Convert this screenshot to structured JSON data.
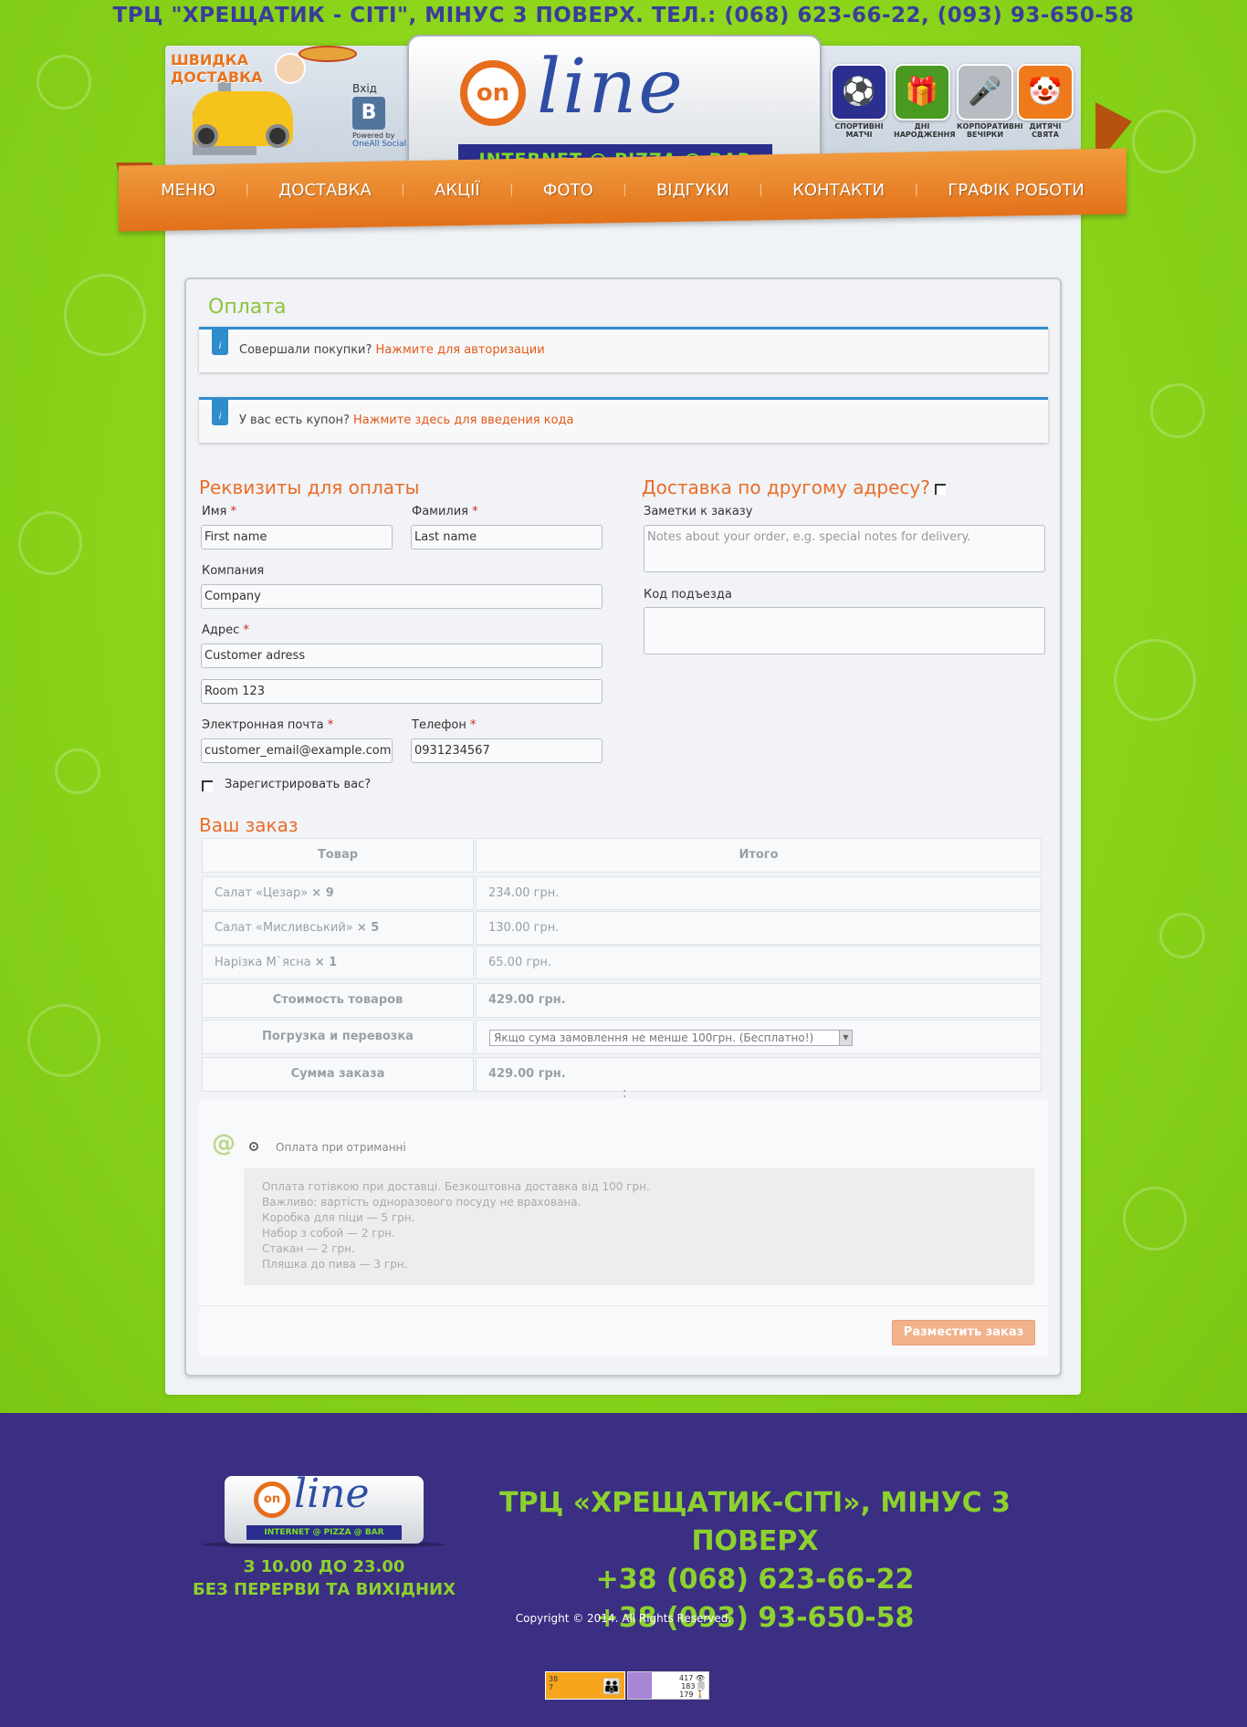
{
  "top_banner": "ТРЦ \"ХРЕЩАТИК - СІТІ\", МІНУС 3 ПОВЕРХ. ТЕЛ.: (068) 623-66-22, (093) 93-650-58",
  "header": {
    "delivery_line1": "ШВИДКА",
    "delivery_line2": "ДОСТАВКА",
    "vk_login_label": "Вхід",
    "vk_button": "B",
    "powered_by": "Powered by",
    "oneall": "OneAll Social",
    "logo_on": "on",
    "logo_line": "line",
    "logo_sub": "INTERNET @ PIZZA @ BAR",
    "events": [
      {
        "label": "СПОРТИВНІ МАТЧІ",
        "icon": "soccer-ball-icon",
        "color": "#2b2f8f",
        "glyph": "⚽"
      },
      {
        "label": "ДНІ НАРОДЖЕННЯ",
        "icon": "gift-icon",
        "color": "#4a9a22",
        "glyph": "🎁"
      },
      {
        "label": "КОРПОРАТИВНІ ВЕЧІРКИ",
        "icon": "microphone-icon",
        "color": "#b8bcc2",
        "glyph": "🎤"
      },
      {
        "label": "ДИТЯЧІ СВЯТА",
        "icon": "clown-icon",
        "color": "#ef7a1c",
        "glyph": "🤡"
      }
    ]
  },
  "nav": {
    "items": [
      "МЕНЮ",
      "ДОСТАВКА",
      "АКЦІЇ",
      "ФОТО",
      "ВІДГУКИ",
      "КОНТАКТИ",
      "ГРАФІК РОБОТИ"
    ]
  },
  "checkout": {
    "title": "Оплата",
    "login_notice": "Совершали покупки?",
    "login_link": "Нажмите для авторизации",
    "coupon_notice": "У вас есть купон?",
    "coupon_link": "Нажмите здесь для введения кода",
    "billing_title": "Реквизиты для оплаты",
    "shipping_title": "Доставка по другому адресу?",
    "first_name_label": "Имя",
    "first_name_value": "First name",
    "last_name_label": "Фамилия",
    "last_name_value": "Last name",
    "company_label": "Компания",
    "company_value": "Company",
    "address_label": "Адрес",
    "address_value": "Customer adress",
    "address2_value": "Room 123",
    "email_label": "Электронная почта",
    "email_value": "customer_email@example.com",
    "phone_label": "Телефон",
    "phone_value": "0931234567",
    "register_label": "Зарегистрировать вас?",
    "notes_label": "Заметки к заказу",
    "notes_placeholder": "Notes about your order, e.g. special notes for delivery.",
    "entrance_code_label": "Код подъезда",
    "required_mark": "*"
  },
  "order": {
    "title": "Ваш заказ",
    "col_product": "Товар",
    "col_total": "Итого",
    "items": [
      {
        "name": "Салат «Цезар»",
        "qty": "× 9",
        "total": "234.00 грн."
      },
      {
        "name": "Салат «Мисливський»",
        "qty": "× 5",
        "total": "130.00 грн."
      },
      {
        "name": "Нарізка М`ясна",
        "qty": "× 1",
        "total": "65.00 грн."
      }
    ],
    "subtotal_label": "Стоимость товаров",
    "subtotal_value": "429.00 грн.",
    "shipping_label": "Погрузка и перевозка",
    "shipping_option": "Якщо сума замовлення не менше 100грн. (Бесплатно!)",
    "total_label": "Сумма заказа",
    "total_value": "429.00 грн."
  },
  "payment": {
    "at_icon": "@",
    "method_label": "Оплата при отриманні",
    "description": [
      "Оплата готівкою при доставці. Безкоштовна доставка від 100 грн.",
      "Важливо: вартість одноразового посуду не врахована.",
      "Коробка для піци — 5 грн.",
      "Набор з собой — 2 грн.",
      "Стакан — 2 грн.",
      "Пляшка до пива — 3 грн."
    ],
    "place_order": "Разместить заказ"
  },
  "footer": {
    "logo_on": "on",
    "logo_line": "line",
    "logo_sub": "INTERNET @ PIZZA @ BAR",
    "hours_line1": "З 10.00 ДО 23.00",
    "hours_line2": "БЕЗ ПЕРЕРВИ ТА ВИХІДНИХ",
    "address": "ТРЦ «ХРЕЩАТИК-СІТІ», МІНУС 3 ПОВЕРХ",
    "phone1": "+38 (068) 623-66-22",
    "phone2": "+38 (093) 93-650-58",
    "copyright": "Copyright © 2014. All Rights Reserved.",
    "counter1_a": "38",
    "counter1_b": "7",
    "counter2_a": "417 👁",
    "counter2_b": "183 🗐",
    "counter2_c": "179 🚶"
  }
}
